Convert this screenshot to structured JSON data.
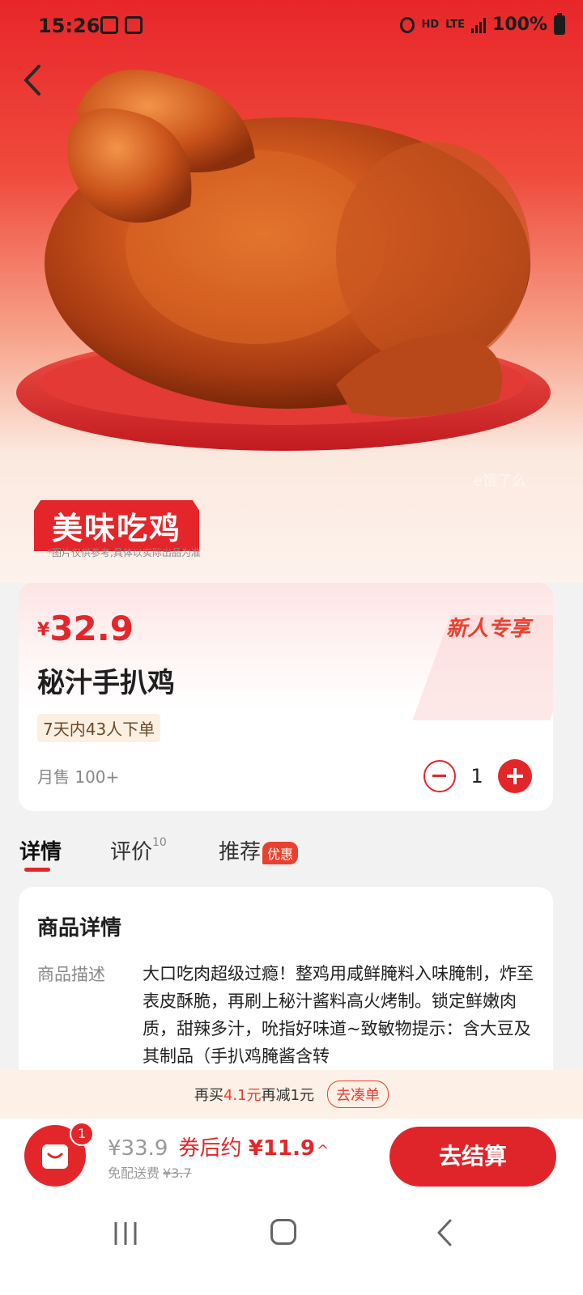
{
  "status_bar": {
    "time": "15:26",
    "network": "HD",
    "lte": "LTE",
    "battery": "100%"
  },
  "hero": {
    "badge_text": "美味吃鸡",
    "badge_note": "*图片仅供参考,具体以实际出品为准"
  },
  "product": {
    "currency": "¥",
    "price": "32.9",
    "new_user_tag": "新人专享",
    "name": "秘汁手扒鸡",
    "orders_tag": "7天内43人下单",
    "monthly_sales": "月售 100+",
    "quantity": "1"
  },
  "tabs": [
    {
      "label": "详情",
      "active": true
    },
    {
      "label": "评价",
      "count": "10"
    },
    {
      "label": "推荐",
      "badge": "优惠"
    }
  ],
  "details": {
    "title": "商品详情",
    "desc_label": "商品描述",
    "desc_text": "大口吃肉超级过瘾！整鸡用咸鲜腌料入味腌制，炸至表皮酥脆，再刷上秘汁酱料高火烤制。锁定鲜嫩肉质，甜辣多汁，吮指好味道~致敏物提示：含大豆及其制品（手扒鸡腌酱含转"
  },
  "promo": {
    "prefix": "再买",
    "amount": "4.1元",
    "suffix": "再减1元",
    "button": "去凑单"
  },
  "bottom_bar": {
    "cart_count": "1",
    "total": "¥33.9",
    "after_coupon_label": "券后约",
    "after_coupon_price": "¥11.9",
    "fee_label": "免配送费",
    "fee_original": "¥3.7",
    "checkout": "去结算"
  },
  "colors": {
    "brand_red": "#e3262a",
    "accent_orange": "#e8412f",
    "promo_bg": "#fdf0e6"
  }
}
